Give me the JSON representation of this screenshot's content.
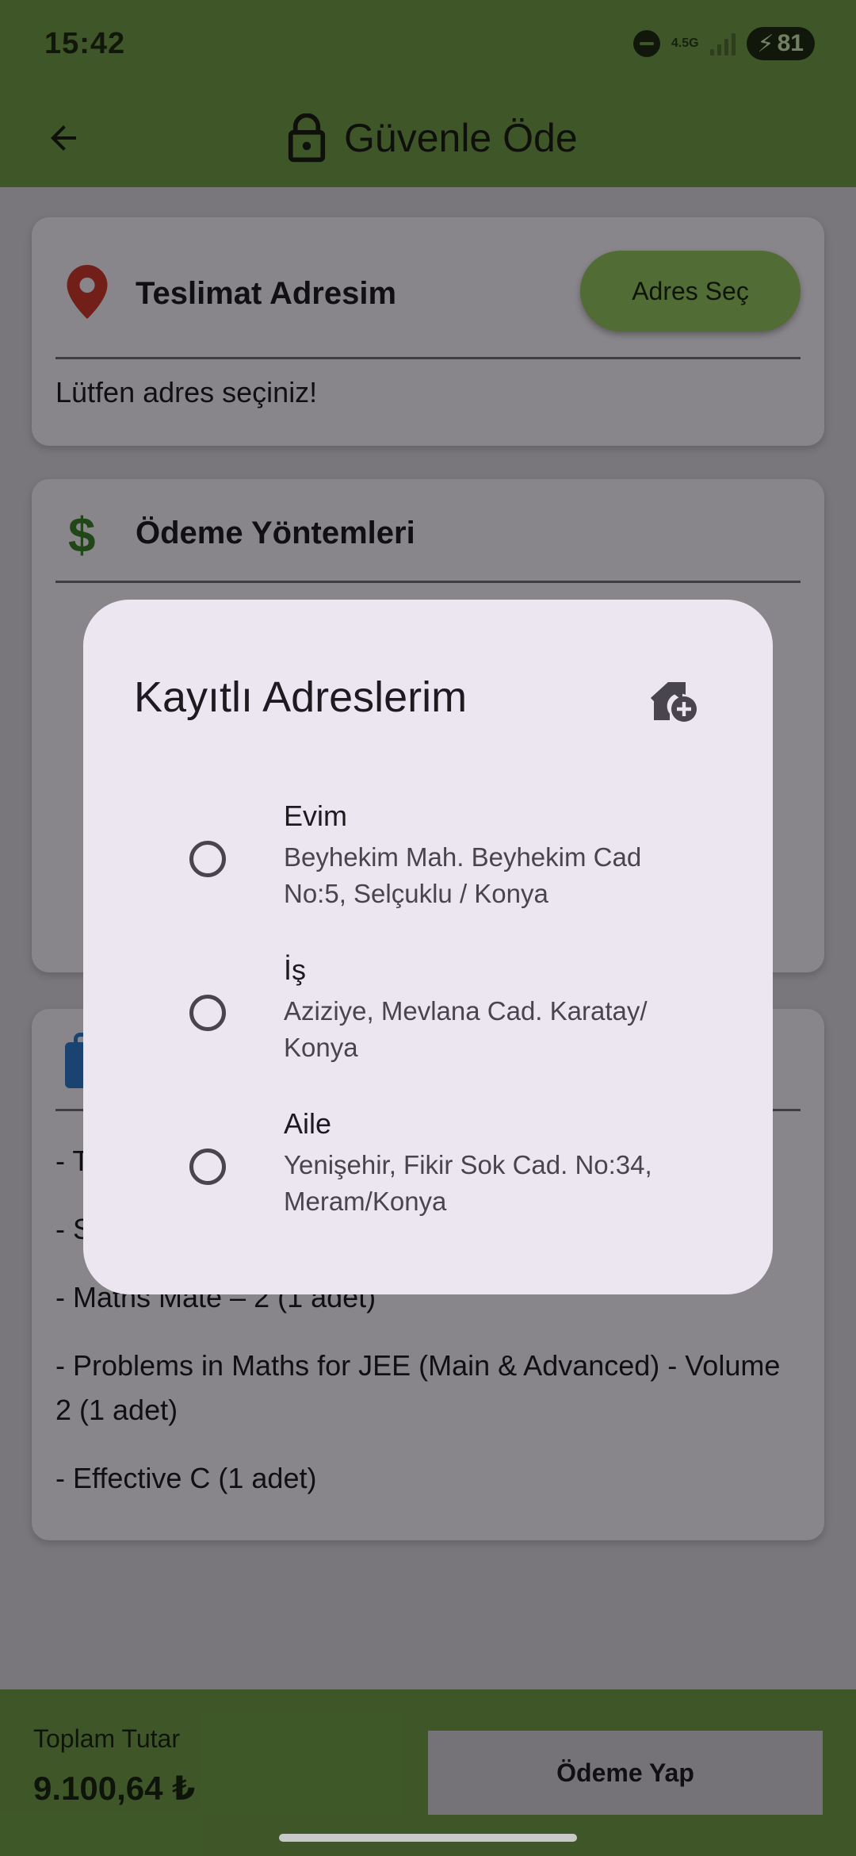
{
  "status_bar": {
    "time": "15:42",
    "network": "4.5G",
    "battery": "81"
  },
  "app_bar": {
    "title": "Güvenle Öde"
  },
  "delivery_card": {
    "title": "Teslimat Adresim",
    "button_label": "Adres Seç",
    "hint": "Lütfen adres seçiniz!"
  },
  "payment_card": {
    "title": "Ödeme Yöntemleri"
  },
  "order_card": {
    "items": [
      "- T",
      "- S",
      "- Maths Mate – 2 (1 adet)",
      "- Problems in Maths for JEE (Main & Advanced) - Volume 2 (1 adet)",
      "- Effective C (1 adet)"
    ]
  },
  "dialog": {
    "title": "Kayıtlı Adreslerim",
    "addresses": [
      {
        "name": "Evim",
        "address": "Beyhekim Mah. Beyhekim Cad No:5, Selçuklu / Konya",
        "selected": false
      },
      {
        "name": "İş",
        "address": "Aziziye, Mevlana Cad. Karatay/ Konya",
        "selected": false
      },
      {
        "name": "Aile",
        "address": "Yenişehir, Fikir Sok Cad. No:34, Meram/Konya",
        "selected": false
      }
    ]
  },
  "bottom_bar": {
    "total_label": "Toplam Tutar",
    "total_value": "9.100,64 ₺",
    "pay_button": "Ödeme Yap"
  },
  "colors": {
    "primary_green": "#6f9a47",
    "button_green": "#8fbf5d",
    "dialog_surface": "#ece6f0",
    "location_red": "#c8372d",
    "dollar_green": "#3b7d2c",
    "bag_blue": "#2f76c8"
  },
  "icons": {
    "back": "arrow-left-icon",
    "lock": "lock-icon",
    "location": "map-pin-icon",
    "dollar": "dollar-icon",
    "bag": "shopping-bag-icon",
    "add_home": "add-home-icon"
  }
}
